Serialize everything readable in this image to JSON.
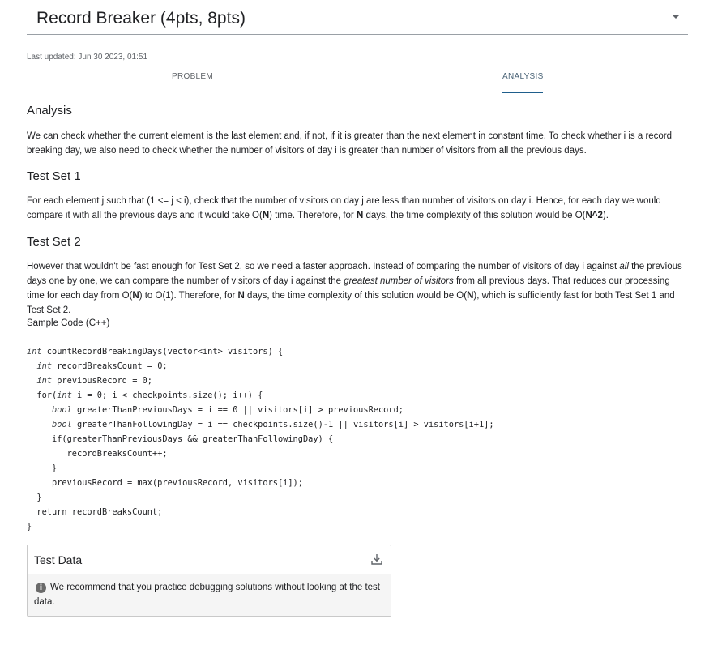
{
  "header": {
    "title": "Record Breaker (4pts, 8pts)"
  },
  "last_updated": "Last updated: Jun 30 2023, 01:51",
  "tabs": [
    {
      "label": "PROBLEM",
      "active": false
    },
    {
      "label": "ANALYSIS",
      "active": true
    }
  ],
  "analysis": {
    "heading": "Analysis",
    "intro": "We can check whether the current element is the last element and, if not, if it is greater than the next element in constant time. To check whether i is a record breaking day, we also need to check whether the number of visitors of day i is greater than number of visitors from all the previous days.",
    "test_set_1": {
      "heading": "Test Set 1",
      "text_a": "For each element j such that (1 <= j < i), check that the number of visitors on day j are less than number of visitors on day i. Hence, for each day we would compare it with all the previous days and it would take O(",
      "text_bold_1": "N",
      "text_b": ") time. Therefore, for ",
      "text_bold_2": "N",
      "text_c": " days, the time complexity of this solution would be O(",
      "text_bold_3": "N^2",
      "text_d": ")."
    },
    "test_set_2": {
      "heading": "Test Set 2",
      "text_a": "However that wouldn't be fast enough for Test Set 2, so we need a faster approach. Instead of comparing the number of visitors of day i against ",
      "text_italic_1": "all",
      "text_b": " the previous days one by one, we can compare the number of visitors of day i against the ",
      "text_italic_2": "greatest number of visitors",
      "text_c": " from all previous days. That reduces our processing time for each day from O(",
      "text_bold_1": "N",
      "text_d": ") to O(1). Therefore, for ",
      "text_bold_2": "N",
      "text_e": " days, the time complexity of this solution would be O(",
      "text_bold_3": "N",
      "text_f": "), which is sufficiently fast for both Test Set 1 and Test Set 2."
    },
    "sample_label": "Sample Code (C++)",
    "code_lines": [
      {
        "pre": "",
        "kw": "int",
        "post": " countRecordBreakingDays(vector<int> visitors) {"
      },
      {
        "pre": "  ",
        "kw": "int",
        "post": " recordBreaksCount = 0;"
      },
      {
        "pre": "  ",
        "kw": "int",
        "post": " previousRecord = 0;"
      },
      {
        "pre": "  for(",
        "kw": "int",
        "post": " i = 0; i < checkpoints.size(); i++) {"
      },
      {
        "pre": "     ",
        "kw": "bool",
        "post": " greaterThanPreviousDays = i == 0 || visitors[i] > previousRecord;"
      },
      {
        "pre": "     ",
        "kw": "bool",
        "post": " greaterThanFollowingDay = i == checkpoints.size()-1 || visitors[i] > visitors[i+1];"
      },
      {
        "pre": "     if(greaterThanPreviousDays && greaterThanFollowingDay) {",
        "kw": "",
        "post": ""
      },
      {
        "pre": "        recordBreaksCount++;",
        "kw": "",
        "post": ""
      },
      {
        "pre": "     }",
        "kw": "",
        "post": ""
      },
      {
        "pre": "     previousRecord = max(previousRecord, visitors[i]);",
        "kw": "",
        "post": ""
      },
      {
        "pre": "  }",
        "kw": "",
        "post": ""
      },
      {
        "pre": "  return recordBreaksCount;",
        "kw": "",
        "post": ""
      },
      {
        "pre": "}",
        "kw": "",
        "post": ""
      }
    ]
  },
  "test_data": {
    "title": "Test Data",
    "download_icon": "download-icon",
    "info_icon": "info-icon",
    "message": "We recommend that you practice debugging solutions without looking at the test data."
  }
}
